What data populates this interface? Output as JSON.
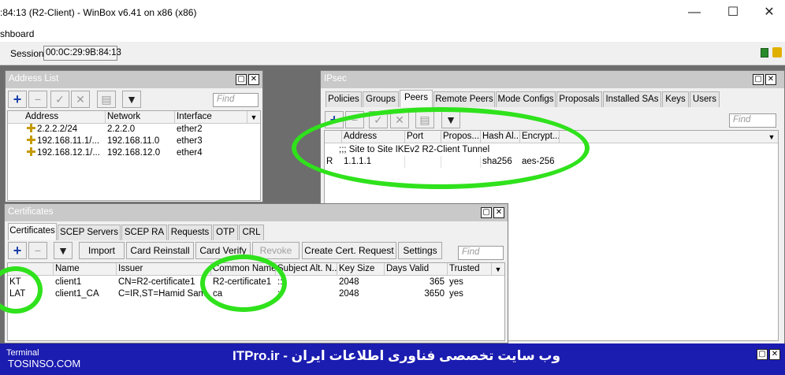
{
  "window": {
    "title": ":84:13 (R2-Client) - WinBox v6.41 on x86 (x86)",
    "controls": [
      "—",
      "☐",
      "✕"
    ],
    "menu": "shboard",
    "session_label": "Session:",
    "session_value": "00:0C:29:9B:84:13"
  },
  "address_list": {
    "title": "Address List",
    "find_placeholder": "Find",
    "columns": [
      "Address",
      "Network",
      "Interface"
    ],
    "rows": [
      {
        "address": "2.2.2.2/24",
        "network": "2.2.2.0",
        "interface": "ether2"
      },
      {
        "address": "192.168.11.1/...",
        "network": "192.168.11.0",
        "interface": "ether3"
      },
      {
        "address": "192.168.12.1/...",
        "network": "192.168.12.0",
        "interface": "ether4"
      }
    ]
  },
  "ipsec": {
    "title": "IPsec",
    "tabs": [
      "Policies",
      "Groups",
      "Peers",
      "Remote Peers",
      "Mode Configs",
      "Proposals",
      "Installed SAs",
      "Keys",
      "Users"
    ],
    "active_tab": "Peers",
    "find_placeholder": "Find",
    "columns": [
      "Address",
      "Port",
      "Propos...",
      "Hash Al...",
      "Encrypt..."
    ],
    "comment": ";;; Site to Site IKEv2 R2-Client Tunnel",
    "rows": [
      {
        "flag": "R",
        "address": "1.1.1.1",
        "port": "",
        "proposal": "",
        "hash": "sha256",
        "encryption": "aes-256"
      }
    ]
  },
  "certificates": {
    "title": "Certificates",
    "tabs": [
      "Certificates",
      "SCEP Servers",
      "SCEP RA",
      "Requests",
      "OTP",
      "CRL"
    ],
    "active_tab": "Certificates",
    "buttons": {
      "import": "Import",
      "card_reinstall": "Card Reinstall",
      "card_verify": "Card Verify",
      "revoke": "Revoke",
      "create_request": "Create Cert. Request",
      "settings": "Settings"
    },
    "find_placeholder": "Find",
    "columns": [
      "Name",
      "Issuer",
      "Common Name",
      "Subject Alt. N...",
      "Key Size",
      "Days Valid",
      "Trusted"
    ],
    "rows": [
      {
        "flag": "KT",
        "name": "client1",
        "issuer": "CN=R2-certificate1",
        "common_name": "R2-certificate1",
        "subject_alt": "::",
        "key_size": "2048",
        "days_valid": "365",
        "trusted": "yes"
      },
      {
        "flag": "LAT",
        "name": "client1_CA",
        "issuer": "C=IR,ST=Hamid Sam...",
        "common_name": "ca",
        "subject_alt": "::",
        "key_size": "2048",
        "days_valid": "3650",
        "trusted": "yes"
      }
    ]
  },
  "footer": {
    "terminal_label": "Terminal",
    "site": "TOSINSO.COM",
    "brand": "ITPro.ir - وب سایت تخصصی فناوری اطلاعات ایران"
  },
  "colors": {
    "highlight_circle": "#2fe21c",
    "footer_bg": "#1b1cb0",
    "workspace_bg": "#6d6d6d"
  }
}
